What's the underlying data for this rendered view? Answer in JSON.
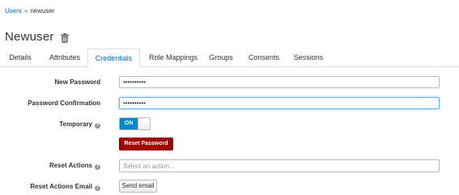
{
  "breadcrumb": {
    "parent": "Users",
    "separator": "»",
    "current": "newuser"
  },
  "header": {
    "title": "Newuser",
    "delete_icon": "trash-icon"
  },
  "tabs": [
    {
      "label": "Details",
      "active": false
    },
    {
      "label": "Attributes",
      "active": false
    },
    {
      "label": "Credentials",
      "active": true
    },
    {
      "label": "Role Mappings",
      "active": false
    },
    {
      "label": "Groups",
      "active": false
    },
    {
      "label": "Consents",
      "active": false
    },
    {
      "label": "Sessions",
      "active": false
    }
  ],
  "form": {
    "new_password": {
      "label": "New Password",
      "value": "••••••••••"
    },
    "password_confirmation": {
      "label": "Password Confirmation",
      "value": "••••••••••"
    },
    "temporary": {
      "label": "Temporary",
      "help_icon": "question-circle-icon",
      "toggle_label": "ON",
      "value": true
    },
    "reset_password_button": "Reset Password",
    "reset_actions": {
      "label": "Reset Actions",
      "help_icon": "question-circle-icon",
      "placeholder": "Select an action..."
    },
    "reset_actions_email": {
      "label": "Reset Actions Email",
      "help_icon": "question-circle-icon",
      "button": "Send email"
    }
  },
  "colors": {
    "link": "#0066cc",
    "toggle_on": "#0088ce",
    "danger": "#a30000",
    "focus": "#66afe9"
  }
}
